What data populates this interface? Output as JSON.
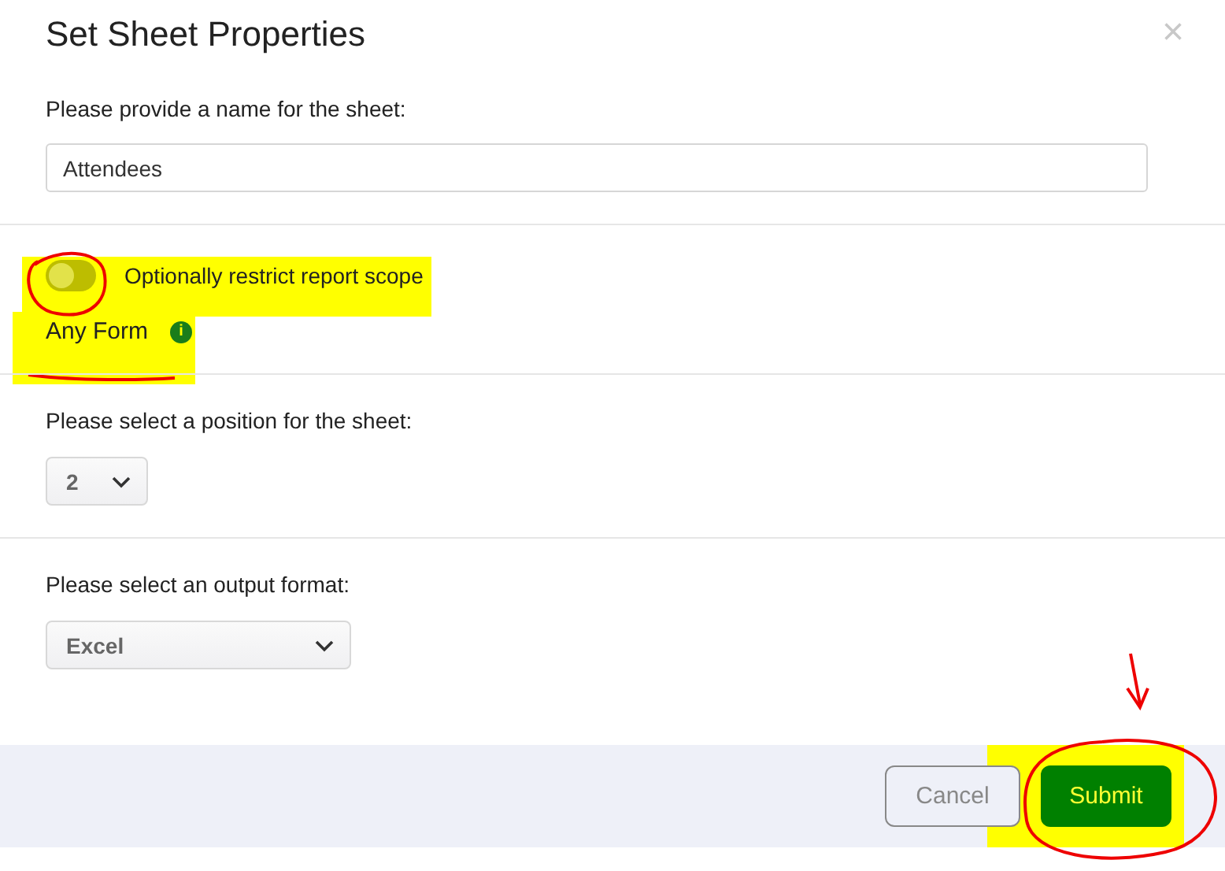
{
  "dialog": {
    "title": "Set Sheet Properties",
    "close": "×"
  },
  "name_field": {
    "label": "Please provide a name for the sheet:",
    "value": "Attendees"
  },
  "scope_toggle": {
    "label": "Optionally restrict report scope",
    "on": false
  },
  "scope_value": {
    "text": "Any Form",
    "info": "i"
  },
  "position_select": {
    "label": "Please select a position for the sheet:",
    "value": "2"
  },
  "format_select": {
    "label": "Please select an output format:",
    "value": "Excel"
  },
  "buttons": [
    {
      "label": "Cancel",
      "kind": "secondary"
    },
    {
      "label": "Submit",
      "kind": "primary"
    }
  ]
}
